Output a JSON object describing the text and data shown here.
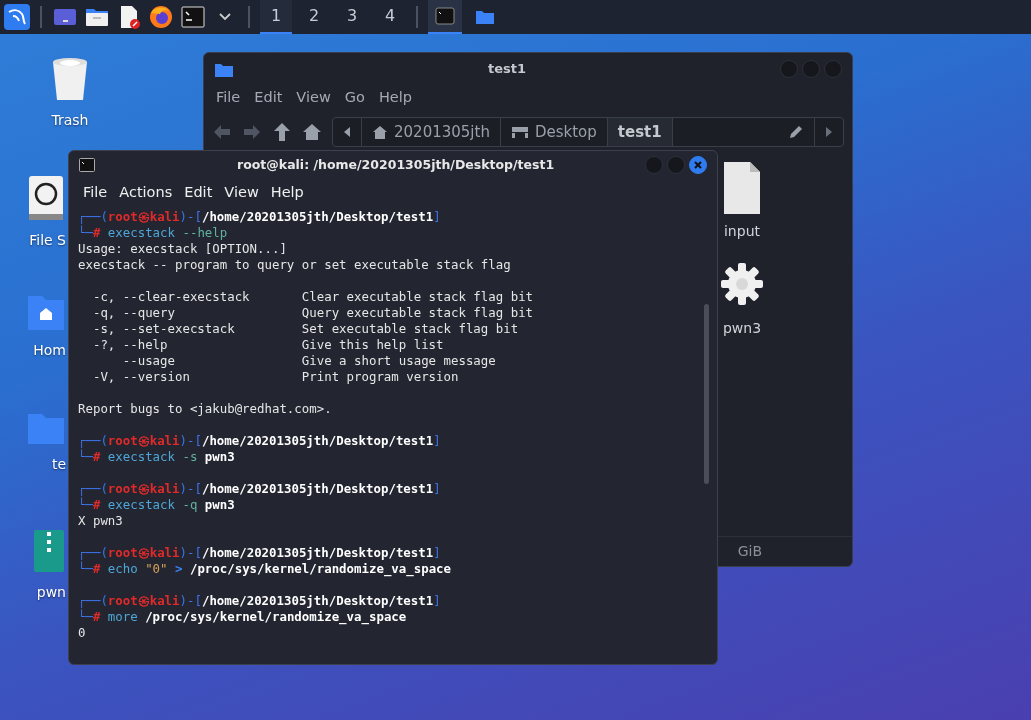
{
  "taskbar": {
    "launchers": [
      {
        "kind": "kali"
      },
      {
        "kind": "desktop"
      },
      {
        "kind": "files"
      },
      {
        "kind": "editor"
      },
      {
        "kind": "firefox"
      },
      {
        "kind": "terminal"
      },
      {
        "kind": "chevron"
      }
    ],
    "workspaces": [
      {
        "label": "1",
        "selected": true
      },
      {
        "label": "2",
        "selected": false
      },
      {
        "label": "3",
        "selected": false
      },
      {
        "label": "4",
        "selected": false
      }
    ],
    "tasks": [
      {
        "kind": "terminal",
        "selected": true
      },
      {
        "kind": "folder",
        "selected": false
      }
    ]
  },
  "desktop_icons": [
    {
      "label": "Trash",
      "kind": "trash"
    },
    {
      "label": "File S",
      "kind": "drive"
    },
    {
      "label": "Hom",
      "kind": "home"
    },
    {
      "label": "te",
      "kind": "folder"
    },
    {
      "label": "pwn",
      "kind": "zip"
    }
  ],
  "file_manager": {
    "title": "test1",
    "menu": [
      "File",
      "Edit",
      "View",
      "Go",
      "Help"
    ],
    "breadcrumb": [
      {
        "label": "20201305jth",
        "kind": "home",
        "selected": false
      },
      {
        "label": "Desktop",
        "kind": "desktop",
        "selected": false
      },
      {
        "label": "test1",
        "kind": "plain",
        "selected": true
      }
    ],
    "files": [
      {
        "label": "input",
        "kind": "binary"
      },
      {
        "label": "pwn3",
        "kind": "gear"
      }
    ],
    "status": "GiB"
  },
  "terminal": {
    "title": "root@kali: /home/20201305jth/Desktop/test1",
    "menu": [
      "File",
      "Actions",
      "Edit",
      "View",
      "Help"
    ],
    "lines": [
      {
        "parts": [
          {
            "text": "┌──(",
            "kind": "frame"
          },
          {
            "text": "root㉿kali",
            "kind": "user"
          },
          {
            "text": ")-[",
            "kind": "frame"
          },
          {
            "text": "/home/20201305jth/Desktop/test1",
            "kind": "path"
          },
          {
            "text": "]",
            "kind": "frame"
          }
        ]
      },
      {
        "parts": [
          {
            "text": "└─",
            "kind": "frame"
          },
          {
            "text": "#",
            "kind": "hash"
          },
          {
            "text": " execstack",
            "kind": "cmd"
          },
          {
            "text": " --help",
            "kind": "opt"
          }
        ]
      },
      {
        "parts": [
          {
            "text": "Usage: execstack [OPTION...]",
            "kind": "out"
          }
        ]
      },
      {
        "parts": [
          {
            "text": "execstack -- program to query or set executable stack flag",
            "kind": "out"
          }
        ]
      },
      {
        "space_before": true,
        "parts": [
          {
            "text": "  -c, --clear-execstack       Clear executable stack flag bit",
            "kind": "out"
          }
        ]
      },
      {
        "parts": [
          {
            "text": "  -q, --query                 Query executable stack flag bit",
            "kind": "out"
          }
        ]
      },
      {
        "parts": [
          {
            "text": "  -s, --set-execstack         Set executable stack flag bit",
            "kind": "out"
          }
        ]
      },
      {
        "parts": [
          {
            "text": "  -?, --help                  Give this help list",
            "kind": "out"
          }
        ]
      },
      {
        "parts": [
          {
            "text": "      --usage                 Give a short usage message",
            "kind": "out"
          }
        ]
      },
      {
        "parts": [
          {
            "text": "  -V, --version               Print program version",
            "kind": "out"
          }
        ]
      },
      {
        "space_before": true,
        "parts": [
          {
            "text": "Report bugs to <jakub@redhat.com>.",
            "kind": "out"
          }
        ]
      },
      {
        "space_before": true,
        "parts": [
          {
            "text": "┌──(",
            "kind": "frame"
          },
          {
            "text": "root㉿kali",
            "kind": "user"
          },
          {
            "text": ")-[",
            "kind": "frame"
          },
          {
            "text": "/home/20201305jth/Desktop/test1",
            "kind": "path"
          },
          {
            "text": "]",
            "kind": "frame"
          }
        ]
      },
      {
        "parts": [
          {
            "text": "└─",
            "kind": "frame"
          },
          {
            "text": "#",
            "kind": "hash"
          },
          {
            "text": " execstack",
            "kind": "cmd"
          },
          {
            "text": " -s",
            "kind": "opt"
          },
          {
            "text": " pwn3",
            "kind": "arg"
          }
        ]
      },
      {
        "space_before": true,
        "parts": [
          {
            "text": "┌──(",
            "kind": "frame"
          },
          {
            "text": "root㉿kali",
            "kind": "user"
          },
          {
            "text": ")-[",
            "kind": "frame"
          },
          {
            "text": "/home/20201305jth/Desktop/test1",
            "kind": "path"
          },
          {
            "text": "]",
            "kind": "frame"
          }
        ]
      },
      {
        "parts": [
          {
            "text": "└─",
            "kind": "frame"
          },
          {
            "text": "#",
            "kind": "hash"
          },
          {
            "text": " execstack",
            "kind": "cmd"
          },
          {
            "text": " -q",
            "kind": "opt"
          },
          {
            "text": " pwn3",
            "kind": "arg"
          }
        ]
      },
      {
        "parts": [
          {
            "text": "X pwn3",
            "kind": "out"
          }
        ]
      },
      {
        "space_before": true,
        "parts": [
          {
            "text": "┌──(",
            "kind": "frame"
          },
          {
            "text": "root㉿kali",
            "kind": "user"
          },
          {
            "text": ")-[",
            "kind": "frame"
          },
          {
            "text": "/home/20201305jth/Desktop/test1",
            "kind": "path"
          },
          {
            "text": "]",
            "kind": "frame"
          }
        ]
      },
      {
        "parts": [
          {
            "text": "└─",
            "kind": "frame"
          },
          {
            "text": "#",
            "kind": "hash"
          },
          {
            "text": " echo",
            "kind": "cmd"
          },
          {
            "text": " \"0\"",
            "kind": "str"
          },
          {
            "text": " >",
            "kind": "op"
          },
          {
            "text": " /proc/sys/kernel/randomize_va_space",
            "kind": "arg"
          }
        ]
      },
      {
        "space_before": true,
        "parts": [
          {
            "text": "┌──(",
            "kind": "frame"
          },
          {
            "text": "root㉿kali",
            "kind": "user"
          },
          {
            "text": ")-[",
            "kind": "frame"
          },
          {
            "text": "/home/20201305jth/Desktop/test1",
            "kind": "path"
          },
          {
            "text": "]",
            "kind": "frame"
          }
        ]
      },
      {
        "parts": [
          {
            "text": "└─",
            "kind": "frame"
          },
          {
            "text": "#",
            "kind": "hash"
          },
          {
            "text": " more",
            "kind": "cmd"
          },
          {
            "text": " /proc/sys/kernel/randomize_va_space",
            "kind": "arg"
          }
        ]
      },
      {
        "parts": [
          {
            "text": "0",
            "kind": "out"
          }
        ]
      }
    ]
  }
}
